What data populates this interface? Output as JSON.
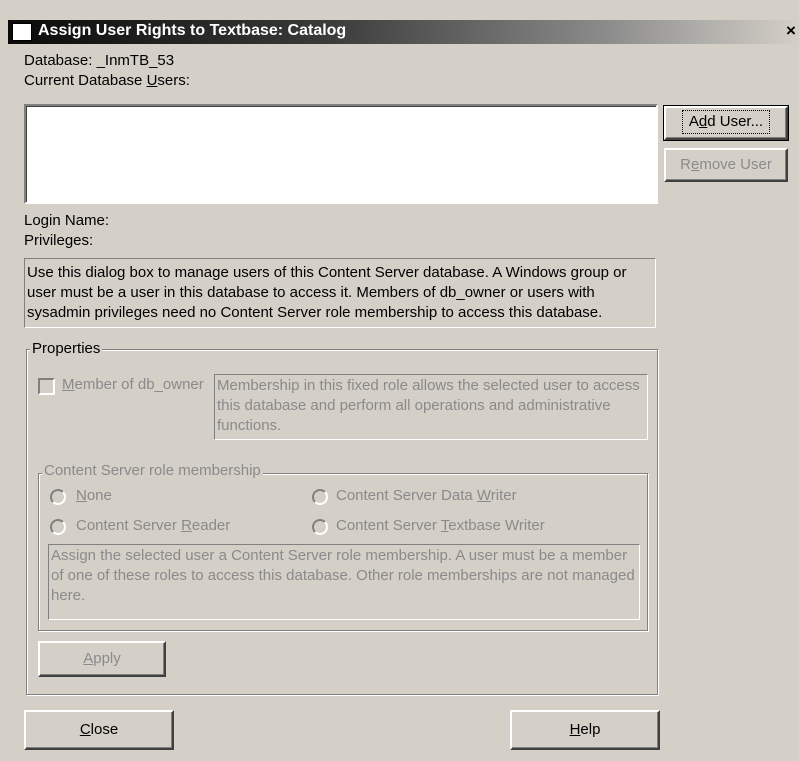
{
  "window": {
    "title": "Assign User Rights to Textbase: Catalog",
    "close_glyph": "×"
  },
  "database": {
    "label": "Database:",
    "name": "_InmTB_53"
  },
  "users": {
    "label_pre": "Current Database ",
    "label_ul": "U",
    "label_post": "sers:",
    "list": []
  },
  "buttons": {
    "add_user_pre": "A",
    "add_user_ul": "d",
    "add_user_post": "d User...",
    "remove_user_pre": "R",
    "remove_user_ul": "e",
    "remove_user_post": "move User",
    "apply_ul": "A",
    "apply_post": "pply",
    "close_ul": "C",
    "close_post": "lose",
    "help_ul": "H",
    "help_post": "elp"
  },
  "fields": {
    "login_name_label": "Login Name:",
    "privileges_label": "Privileges:"
  },
  "info_text": "Use this dialog box to manage users of this Content Server database. A Windows group or user must be a user in this database to access it. Members of db_owner or users with sysadmin privileges need no Content Server role membership to access this database.",
  "properties": {
    "legend": "Properties",
    "member_db_owner_ul": "M",
    "member_db_owner_post": "ember of db_owner",
    "member_db_owner_checked": false,
    "db_owner_desc": "Membership in this fixed role allows the selected user to access this database and perform all operations and administrative functions.",
    "role_group": {
      "legend": "Content Server role membership",
      "options": {
        "none_ul": "N",
        "none_post": "one",
        "reader_pre": "Content Server ",
        "reader_ul": "R",
        "reader_post": "eader",
        "data_writer_pre": "Content Server Data ",
        "data_writer_ul": "W",
        "data_writer_post": "riter",
        "textbase_writer_pre": "Content Server ",
        "textbase_writer_ul": "T",
        "textbase_writer_post": "extbase Writer"
      },
      "selected": null,
      "desc": "Assign the selected user a Content Server role membership. A user must be a member of one of these roles to access this database. Other role memberships are not managed here."
    }
  },
  "colors": {
    "dialog_bg": "#d4d0c8",
    "disabled_text": "#8a8a8a",
    "title_gradient_start": "#0a0a0a"
  }
}
